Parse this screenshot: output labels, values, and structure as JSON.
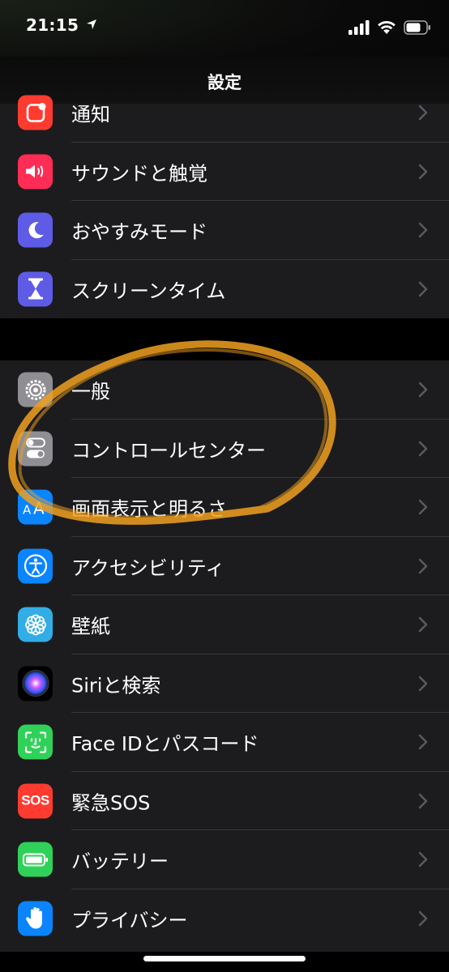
{
  "status_bar": {
    "time": "21:15"
  },
  "nav": {
    "title": "設定"
  },
  "group1": [
    {
      "label": "通知",
      "icon": "notifications-icon",
      "color": "#ff3b30"
    },
    {
      "label": "サウンドと触覚",
      "icon": "sound-icon",
      "color": "#ff2d55"
    },
    {
      "label": "おやすみモード",
      "icon": "moon-icon",
      "color": "#5e5ce6"
    },
    {
      "label": "スクリーンタイム",
      "icon": "hourglass-icon",
      "color": "#5e5ce6"
    }
  ],
  "group2": [
    {
      "label": "一般",
      "icon": "gear-icon",
      "color": "#8e8e93"
    },
    {
      "label": "コントロールセンター",
      "icon": "toggles-icon",
      "color": "#8e8e93"
    },
    {
      "label": "画面表示と明るさ",
      "icon": "text-size-icon",
      "color": "#0a84ff"
    },
    {
      "label": "アクセシビリティ",
      "icon": "accessibility-icon",
      "color": "#0a84ff"
    },
    {
      "label": "壁紙",
      "icon": "flower-icon",
      "color": "#32ade6"
    },
    {
      "label": "Siriと検索",
      "icon": "siri-icon",
      "color": "#000000"
    },
    {
      "label": "Face IDとパスコード",
      "icon": "face-id-icon",
      "color": "#30d158"
    },
    {
      "label": "緊急SOS",
      "icon": "sos-icon",
      "color": "#ff3b30",
      "icon_text": "SOS"
    },
    {
      "label": "バッテリー",
      "icon": "battery-icon",
      "color": "#30d158"
    },
    {
      "label": "プライバシー",
      "icon": "hand-icon",
      "color": "#0a84ff"
    }
  ],
  "annotation_color": "#f0a020"
}
